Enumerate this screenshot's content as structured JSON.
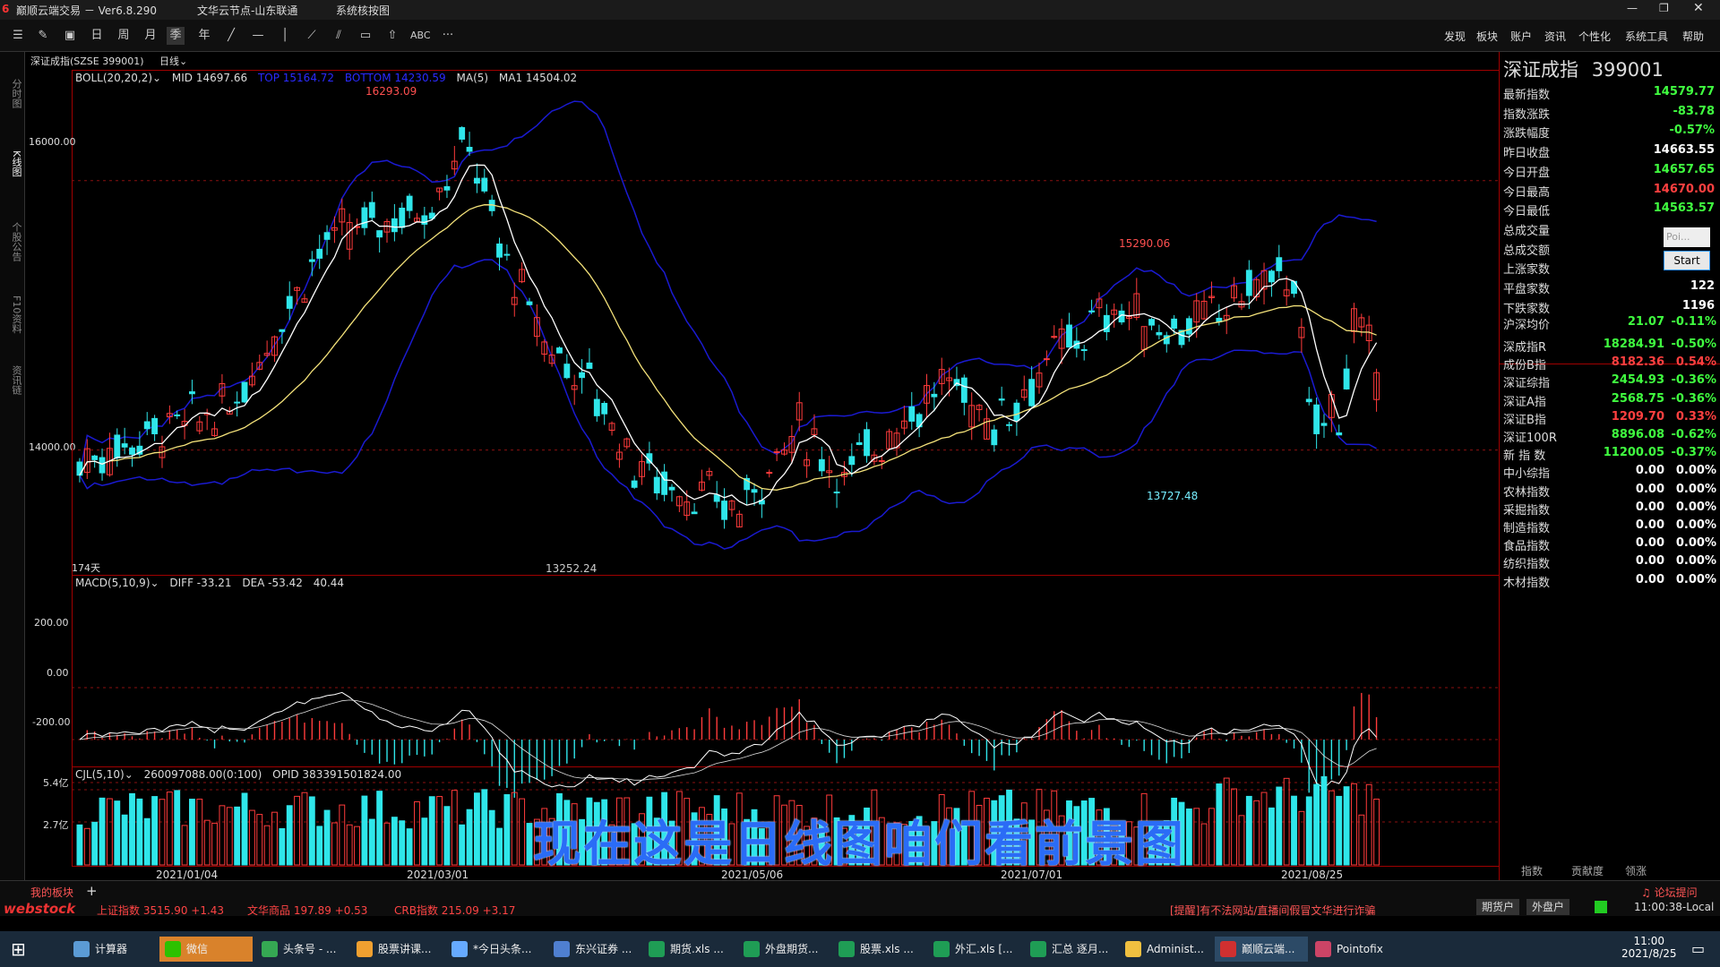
{
  "titlebar": {
    "app_title": "巅顺云端交易 － Ver6.8.290",
    "server": "文华云节点-山东联通",
    "sys_module": "系统核按图"
  },
  "toolbar": {
    "period_day": "日",
    "period_week": "周",
    "period_month": "月",
    "period_quarter": "季",
    "period_year": "年",
    "abc": "ABC",
    "more": "···",
    "menu": [
      "发现",
      "板块",
      "账户",
      "资讯",
      "个性化",
      "系统工具",
      "帮助"
    ]
  },
  "leftrail": [
    "分时图",
    "K线图",
    "个股公告",
    "F10资料",
    "资讯链"
  ],
  "chart": {
    "instrument_tab": "深证成指(SZSE 399001)",
    "period_select": "日线",
    "boll_label": "BOLL(20,20,2)",
    "mid_label": "MID 14697.66",
    "top_label": "TOP 15164.72",
    "bottom_label": "BOTTOM 14230.59",
    "ma_label": "MA(5)",
    "ma1_label": "MA1 14504.02",
    "days_label": "174天",
    "macd_label": "MACD(5,10,9)",
    "diff_label": "DIFF -33.21",
    "dea_label": "DEA -53.42",
    "macd_val": "40.44",
    "cjl_label": "CJL(5,10)",
    "cjl_val": "260097088.00(0:100)",
    "opid_label": "OPID 383391501824.00",
    "annot_high": "16293.09",
    "annot_peak2": "15290.06",
    "annot_low1": "13252.24",
    "annot_low2": "13727.48",
    "price_ticks": [
      "16000.00",
      "14000.00"
    ],
    "macd_ticks": [
      "200.00",
      "0.00",
      "-200.00"
    ],
    "vol_ticks": [
      "5.4亿",
      "2.7亿"
    ],
    "dates": [
      "2021/01/04",
      "2021/03/01",
      "2021/05/06",
      "2021/07/01",
      "2021/08/25"
    ],
    "colors": {
      "up": "#ff3b3b",
      "down": "#2fe6ea",
      "ma": "#ffffff",
      "mid": "#f4e27a",
      "band": "#1a1ad0",
      "grid": "#8a1010"
    }
  },
  "chart_data": {
    "type": "candlestick",
    "x_range": [
      "2021/01/04",
      "2021/08/25"
    ],
    "price_ylim": [
      13252.24,
      16293.09
    ],
    "annotations": [
      {
        "label": "16293.09",
        "kind": "high",
        "date": "2021/02"
      },
      {
        "label": "15290.06",
        "kind": "local-high",
        "date": "2021/07"
      },
      {
        "label": "13252.24",
        "kind": "low",
        "date": "2021/03"
      },
      {
        "label": "13727.48",
        "kind": "local-low",
        "date": "2021/07"
      }
    ],
    "indicators": [
      "BOLL(20,20,2)",
      "MA(5)",
      "MACD(5,10,9)",
      "CJL(5,10)"
    ]
  },
  "rightpanel": {
    "title": "深证成指",
    "code": "399001",
    "quotes": [
      {
        "label": "最新指数",
        "v": "14579.77",
        "c": "down"
      },
      {
        "label": "指数涨跌",
        "v": "-83.78",
        "c": "down"
      },
      {
        "label": "涨跌幅度",
        "v": "-0.57%",
        "c": "down"
      },
      {
        "label": "昨日收盘",
        "v": "14663.55",
        "c": "flat"
      },
      {
        "label": "今日开盘",
        "v": "14657.65",
        "c": "down"
      },
      {
        "label": "今日最高",
        "v": "14670.00",
        "c": "up"
      },
      {
        "label": "今日最低",
        "v": "14563.57",
        "c": "down"
      },
      {
        "label": "总成交量",
        "v": "",
        "c": "flat"
      },
      {
        "label": "总成交额",
        "v": "",
        "c": "flat"
      },
      {
        "label": "上涨家数",
        "v": "",
        "c": "flat"
      },
      {
        "label": "平盘家数",
        "v": "122",
        "c": "flat"
      },
      {
        "label": "下跌家数",
        "v": "1196",
        "c": "flat"
      }
    ],
    "avg": {
      "label": "沪深均价",
      "v1": "21.07",
      "v2": "-0.11%"
    },
    "indices": [
      {
        "label": "深成指R",
        "v1": "18284.91",
        "v2": "-0.50%",
        "c1": "down",
        "c2": "down"
      },
      {
        "label": "成份B指",
        "v1": "8182.36",
        "v2": "0.54%",
        "c1": "up",
        "c2": "up"
      },
      {
        "label": "深证综指",
        "v1": "2454.93",
        "v2": "-0.36%",
        "c1": "down",
        "c2": "down"
      },
      {
        "label": "深证A指",
        "v1": "2568.75",
        "v2": "-0.36%",
        "c1": "down",
        "c2": "down"
      },
      {
        "label": "深证B指",
        "v1": "1209.70",
        "v2": "0.33%",
        "c1": "up",
        "c2": "up"
      },
      {
        "label": "深证100R",
        "v1": "8896.08",
        "v2": "-0.62%",
        "c1": "down",
        "c2": "down"
      },
      {
        "label": "新 指 数",
        "v1": "11200.05",
        "v2": "-0.37%",
        "c1": "down",
        "c2": "down"
      },
      {
        "label": "中小综指",
        "v1": "0.00",
        "v2": "0.00%",
        "c1": "flat",
        "c2": "flat"
      },
      {
        "label": "农林指数",
        "v1": "0.00",
        "v2": "0.00%",
        "c1": "flat",
        "c2": "flat"
      },
      {
        "label": "采掘指数",
        "v1": "0.00",
        "v2": "0.00%",
        "c1": "flat",
        "c2": "flat"
      },
      {
        "label": "制造指数",
        "v1": "0.00",
        "v2": "0.00%",
        "c1": "flat",
        "c2": "flat"
      },
      {
        "label": "食品指数",
        "v1": "0.00",
        "v2": "0.00%",
        "c1": "flat",
        "c2": "flat"
      },
      {
        "label": "纺织指数",
        "v1": "0.00",
        "v2": "0.00%",
        "c1": "flat",
        "c2": "flat"
      },
      {
        "label": "木材指数",
        "v1": "0.00",
        "v2": "0.00%",
        "c1": "flat",
        "c2": "flat"
      }
    ],
    "tabs": [
      "指数",
      "贡献度",
      "领涨"
    ],
    "popup_input": "Poi...",
    "popup_button": "Start"
  },
  "bottombar": {
    "myboard": "我的板块",
    "add": "+",
    "logo": "webstock",
    "tickers": [
      {
        "name": "上证指数",
        "v": "3515.90",
        "d": "+1.43"
      },
      {
        "name": "文华商品",
        "v": "197.89",
        "d": "+0.53"
      },
      {
        "name": "CRB指数",
        "v": "215.09",
        "d": "+3.17"
      }
    ],
    "warning": "[提醒]有不法网站/直播间假冒文华进行诈骗",
    "forum": "论坛提问",
    "futures_acct": "期货户",
    "fx_acct": "外盘户",
    "time_local": "11:00:38-Local"
  },
  "subtitle": "现在这是日线图咱们看前景图",
  "taskbar": {
    "items": [
      "计算器",
      "微信",
      "头条号 - ...",
      "股票讲课...",
      "*今日头条...",
      "东兴证券 ...",
      "期货.xls ...",
      "外盘期货...",
      "股票.xls ...",
      "外汇.xls [...",
      "汇总 逐月...",
      "Administ...",
      "巅顺云端...",
      "Pointofix"
    ],
    "clock_time": "11:00",
    "clock_date": "2021/8/25"
  }
}
